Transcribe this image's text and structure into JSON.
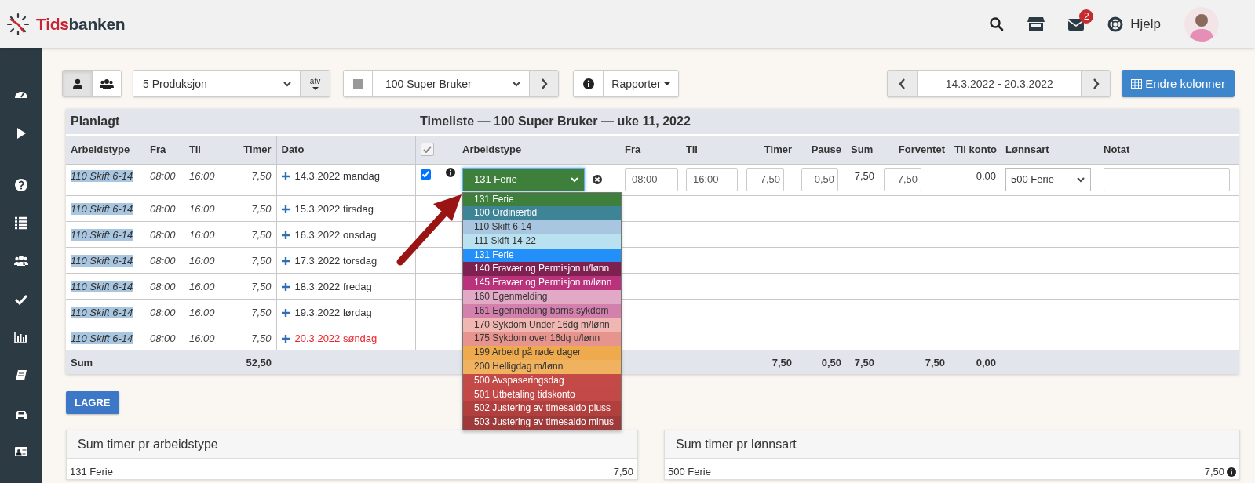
{
  "header": {
    "logo": {
      "accent": "Tids",
      "rest": "banken"
    },
    "mail_badge": "2",
    "help": "Hjelp"
  },
  "toolbar": {
    "view_toggle": [
      {
        "selected": true
      },
      {
        "selected": false
      }
    ],
    "department": "5 Produksjon",
    "atv": "atv",
    "employee": "100 Super Bruker",
    "reports": "Rapporter",
    "date_range": "14.3.2022 - 20.3.2022",
    "change_columns": "Endre kolonner"
  },
  "timesheet": {
    "planned_title": "Planlagt",
    "title": "Timeliste — 100 Super Bruker — uke 11, 2022",
    "planned_columns": [
      "Arbeidstype",
      "Fra",
      "Til",
      "Timer",
      "Dato"
    ],
    "select_all_checked": true,
    "columns": [
      "Arbeidstype",
      "Fra",
      "Til",
      "Timer",
      "Pause",
      "Sum",
      "Forventet",
      "Til konto",
      "Lønnsart",
      "Notat"
    ],
    "rows": [
      {
        "planned": {
          "arbeidstype": "110 Skift 6-14",
          "fra": "08:00",
          "til": "16:00",
          "timer": "7,50"
        },
        "date": "14.3.2022 mandag",
        "red_day": false,
        "entry": {
          "checked": true,
          "arbeidstype": {
            "value": "131 Ferie",
            "color": "#3d7f3b",
            "expanded": true,
            "options": [
              {
                "label": "131 Ferie",
                "color": "#3d7f3b"
              },
              {
                "label": "100 Ordinærtid",
                "color": "#3e8497"
              },
              {
                "label": "110 Skift 6-14",
                "color": "#a9c6e0"
              },
              {
                "label": "111 Skift 14-22",
                "color": "#b9e1f0"
              },
              {
                "label": "131 Ferie",
                "color": "#2290f8"
              },
              {
                "label": "140 Fravær og Permisjon u/lønn",
                "color": "#7e2050"
              },
              {
                "label": "145 Fravær og Permisjon m/lønn",
                "color": "#b8337b"
              },
              {
                "label": "160 Egenmelding",
                "color": "#e2a9c6"
              },
              {
                "label": "161 Egenmelding barns sykdom",
                "color": "#d480ad"
              },
              {
                "label": "170 Sykdom Under 16dg m/lønn",
                "color": "#f0b7b2"
              },
              {
                "label": "175 Sykdom over 16dg u/lønn",
                "color": "#e8948e"
              },
              {
                "label": "199 Arbeid på røde dager",
                "color": "#eeaa4c"
              },
              {
                "label": "200 Helligdag m/lønn",
                "color": "#f0b25e"
              },
              {
                "label": "500 Avspaseringsdag",
                "color": "#c44a48"
              },
              {
                "label": "501 Utbetaling tidskonto",
                "color": "#c24947"
              },
              {
                "label": "502 Justering av timesaldo pluss",
                "color": "#b03f3e"
              },
              {
                "label": "503 Justering av timesaldo minus",
                "color": "#9e3a3a"
              }
            ]
          },
          "fra": "08:00",
          "til": "16:00",
          "timer": "7,50",
          "pause": "0,50",
          "sum": "7,50",
          "forventet": "7,50",
          "til_konto": "0,00",
          "lonnsart": "500 Ferie"
        }
      },
      {
        "planned": {
          "arbeidstype": "110 Skift 6-14",
          "fra": "08:00",
          "til": "16:00",
          "timer": "7,50"
        },
        "date": "15.3.2022 tirsdag",
        "red_day": false
      },
      {
        "planned": {
          "arbeidstype": "110 Skift 6-14",
          "fra": "08:00",
          "til": "16:00",
          "timer": "7,50"
        },
        "date": "16.3.2022 onsdag",
        "red_day": false
      },
      {
        "planned": {
          "arbeidstype": "110 Skift 6-14",
          "fra": "08:00",
          "til": "16:00",
          "timer": "7,50"
        },
        "date": "17.3.2022 torsdag",
        "red_day": false
      },
      {
        "planned": {
          "arbeidstype": "110 Skift 6-14",
          "fra": "08:00",
          "til": "16:00",
          "timer": "7,50"
        },
        "date": "18.3.2022 fredag",
        "red_day": false
      },
      {
        "planned": {
          "arbeidstype": "110 Skift 6-14",
          "fra": "08:00",
          "til": "16:00",
          "timer": "7,50"
        },
        "date": "19.3.2022 lørdag",
        "red_day": false
      },
      {
        "planned": {
          "arbeidstype": "110 Skift 6-14",
          "fra": "08:00",
          "til": "16:00",
          "timer": "7,50"
        },
        "date": "20.3.2022 søndag",
        "red_day": true
      }
    ],
    "sum": {
      "label": "Sum",
      "planned_timer": "52,50",
      "timer": "7,50",
      "pause": "0,50",
      "sum": "7,50",
      "forventet": "7,50",
      "til_konto": "0,00"
    }
  },
  "save": "LAGRE",
  "summaries": [
    {
      "title": "Sum timer pr arbeidstype",
      "rows": [
        {
          "label": "131 Ferie",
          "value": "7,50",
          "info": false
        }
      ]
    },
    {
      "title": "Sum timer pr lønnsart",
      "rows": [
        {
          "label": "500 Ferie",
          "value": "7,50",
          "info": true
        }
      ]
    }
  ]
}
